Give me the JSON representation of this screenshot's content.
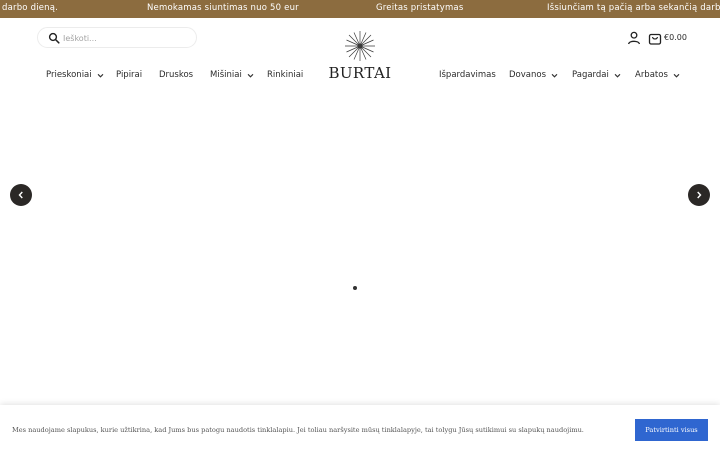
{
  "announcement": {
    "messages": [
      "darbo dieną.",
      "Nemokamas siuntimas nuo 50 eur",
      "Greitas pristatymas",
      "Išsiunčiam tą pačią arba sekančią darbo dieną."
    ],
    "background": "#8c6c3f"
  },
  "header": {
    "search_placeholder": "Ieškoti...",
    "logo_text": "BURTAI",
    "cart_total": "€0.00"
  },
  "nav": {
    "left": [
      {
        "label": "Prieskoniai",
        "dropdown": true
      },
      {
        "label": "Pipirai",
        "dropdown": false
      },
      {
        "label": "Druskos",
        "dropdown": false
      },
      {
        "label": "Mišiniai",
        "dropdown": true
      },
      {
        "label": "Rinkiniai",
        "dropdown": false
      }
    ],
    "right": [
      {
        "label": "Išpardavimas",
        "dropdown": false
      },
      {
        "label": "Dovanos",
        "dropdown": true
      },
      {
        "label": "Pagardai",
        "dropdown": true
      },
      {
        "label": "Arbatos",
        "dropdown": true
      }
    ]
  },
  "slider": {
    "prev_icon": "chevron-left-icon",
    "next_icon": "chevron-right-icon",
    "active_slide": 1,
    "slide_count": 1
  },
  "cookie": {
    "text": "Mes naudojame slapukus, kurie užtikrina, kad Jums bus patogu naudotis tinklalapiu. Jei toliau naršysite mūsų tinklalapyje, tai tolygu Jūsų sutikimui su slapukų naudojimu.",
    "button_label": "Patvirtinti visus",
    "button_color": "#2f66d0"
  }
}
